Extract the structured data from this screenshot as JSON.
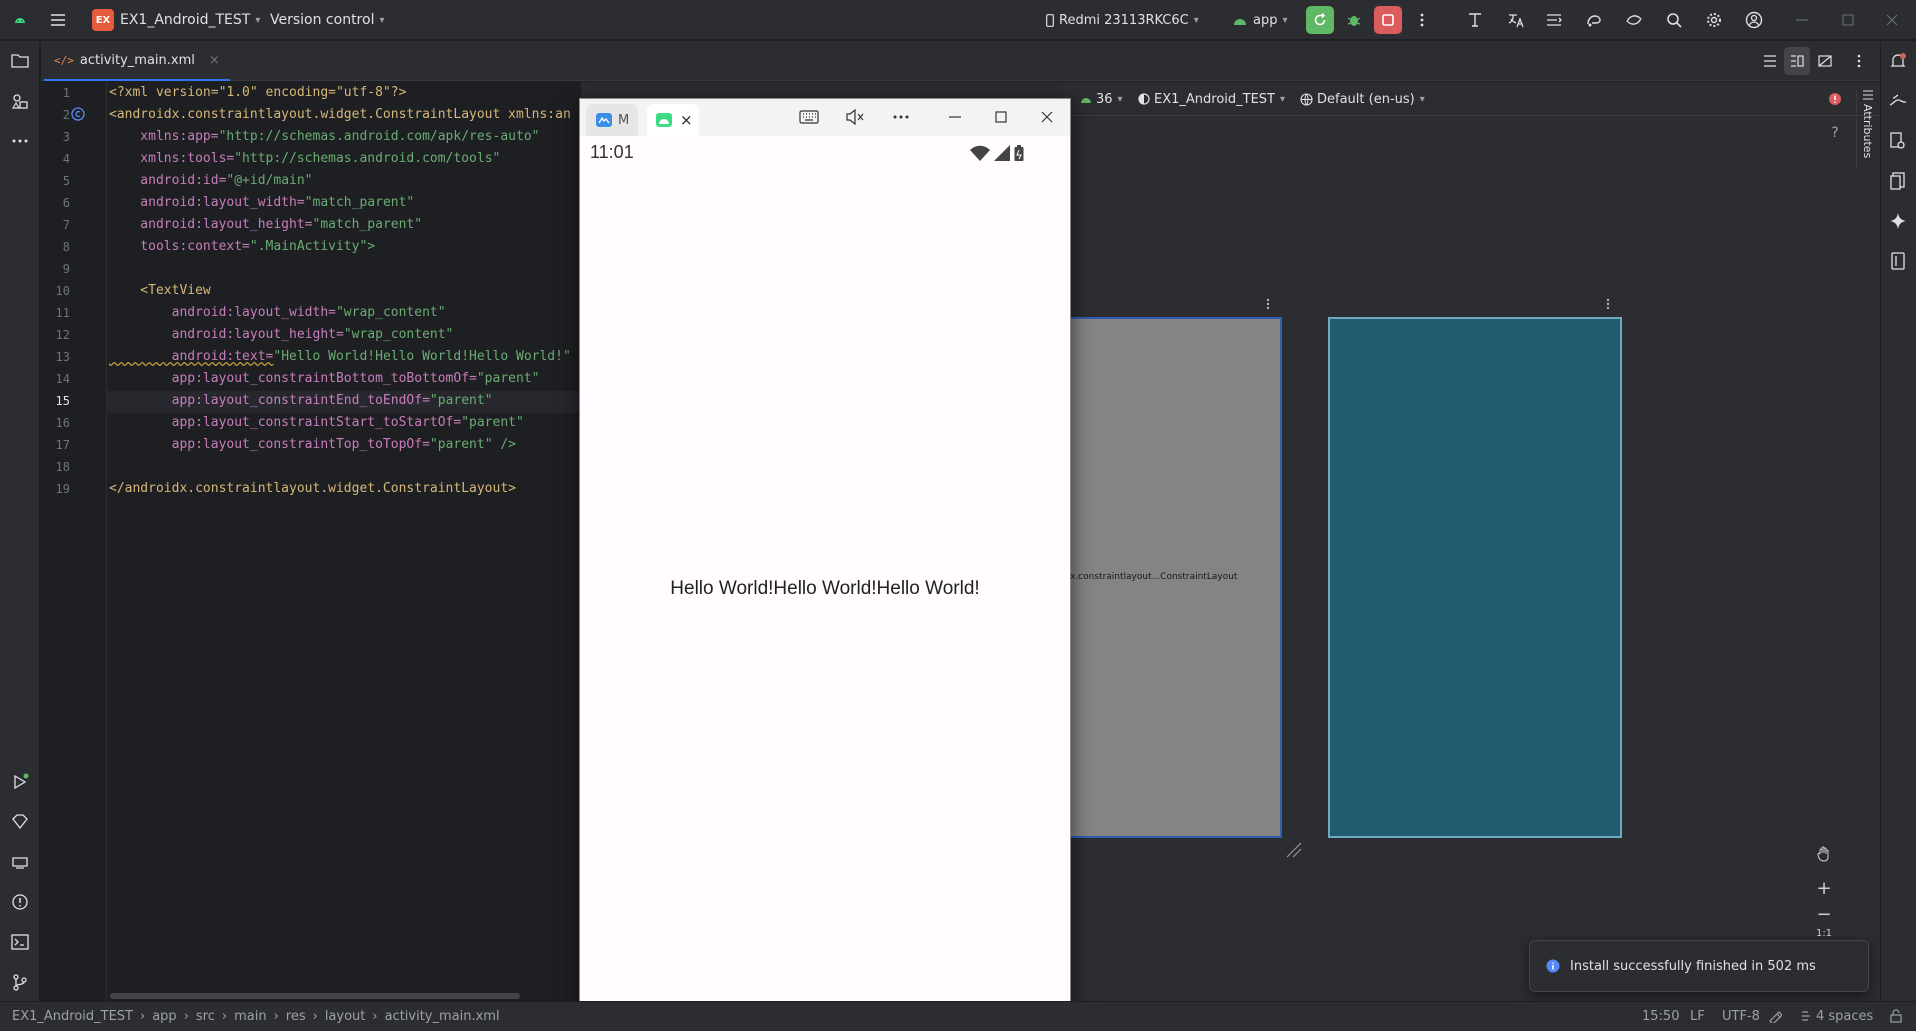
{
  "titlebar": {
    "project_badge": "EX",
    "project_name": "EX1_Android_TEST",
    "vcs": "Version control",
    "device": "Redmi 23113RKC6C",
    "run_config": "app"
  },
  "tab": {
    "filename": "activity_main.xml"
  },
  "editor": {
    "line_numbers": [
      "1",
      "2",
      "3",
      "4",
      "5",
      "6",
      "7",
      "8",
      "9",
      "10",
      "11",
      "12",
      "13",
      "14",
      "15",
      "16",
      "17",
      "18",
      "19"
    ],
    "lines": [
      [
        "<?xml version=\"1.0\" encoding=\"utf-8\"?>"
      ],
      [
        "<androidx.constraintlayout.widget.ConstraintLayout xmlns:an"
      ],
      [
        "    xmlns:app=",
        "\"http://schemas.android.com/apk/res-auto\""
      ],
      [
        "    xmlns:tools=",
        "\"http://schemas.android.com/tools\""
      ],
      [
        "    android:id=",
        "\"@+id/main\""
      ],
      [
        "    android:layout_width=",
        "\"match_parent\""
      ],
      [
        "    android:layout_height=",
        "\"match_parent\""
      ],
      [
        "    tools:context=",
        "\".MainActivity\">"
      ],
      [
        ""
      ],
      [
        "    <TextView"
      ],
      [
        "        android:layout_width=",
        "\"wrap_content\""
      ],
      [
        "        android:layout_height=",
        "\"wrap_content\""
      ],
      [
        "        android:text=",
        "\"Hello World!Hello World!Hello World!\""
      ],
      [
        "        app:layout_constraintBottom_toBottomOf=",
        "\"parent\""
      ],
      [
        "        app:layout_constraintEnd_toEndOf=",
        "\"parent\""
      ],
      [
        "        app:layout_constraintStart_toStartOf=",
        "\"parent\""
      ],
      [
        "        app:layout_constraintTop_toTopOf=",
        "\"parent\" />"
      ],
      [
        ""
      ],
      [
        "</androidx.constraintlayout.widget.ConstraintLayout>"
      ]
    ]
  },
  "design_toolbar": {
    "api": "36",
    "theme": "EX1_Android_TEST",
    "locale": "Default (en-us)",
    "warnings": "1",
    "errors": "1"
  },
  "design": {
    "design_label": "x.constraintlayout...ConstraintLayout",
    "attributes_tab": "Attributes",
    "zoom_ratio": "1:1"
  },
  "emulator": {
    "tab1_label": "M",
    "time": "11:01",
    "hello_text": "Hello World!Hello World!Hello World!"
  },
  "notification": {
    "text": "Install successfully finished in 502 ms"
  },
  "statusbar": {
    "breadcrumbs": [
      "EX1_Android_TEST",
      "app",
      "src",
      "main",
      "res",
      "layout",
      "activity_main.xml"
    ],
    "position": "15:50",
    "line_sep": "LF",
    "encoding": "UTF-8",
    "indent": "4 spaces"
  },
  "colors": {
    "accent": "#3574f0",
    "run_green": "#5fb865",
    "stop_red": "#db5c5c",
    "blueprint": "#225a6e"
  }
}
